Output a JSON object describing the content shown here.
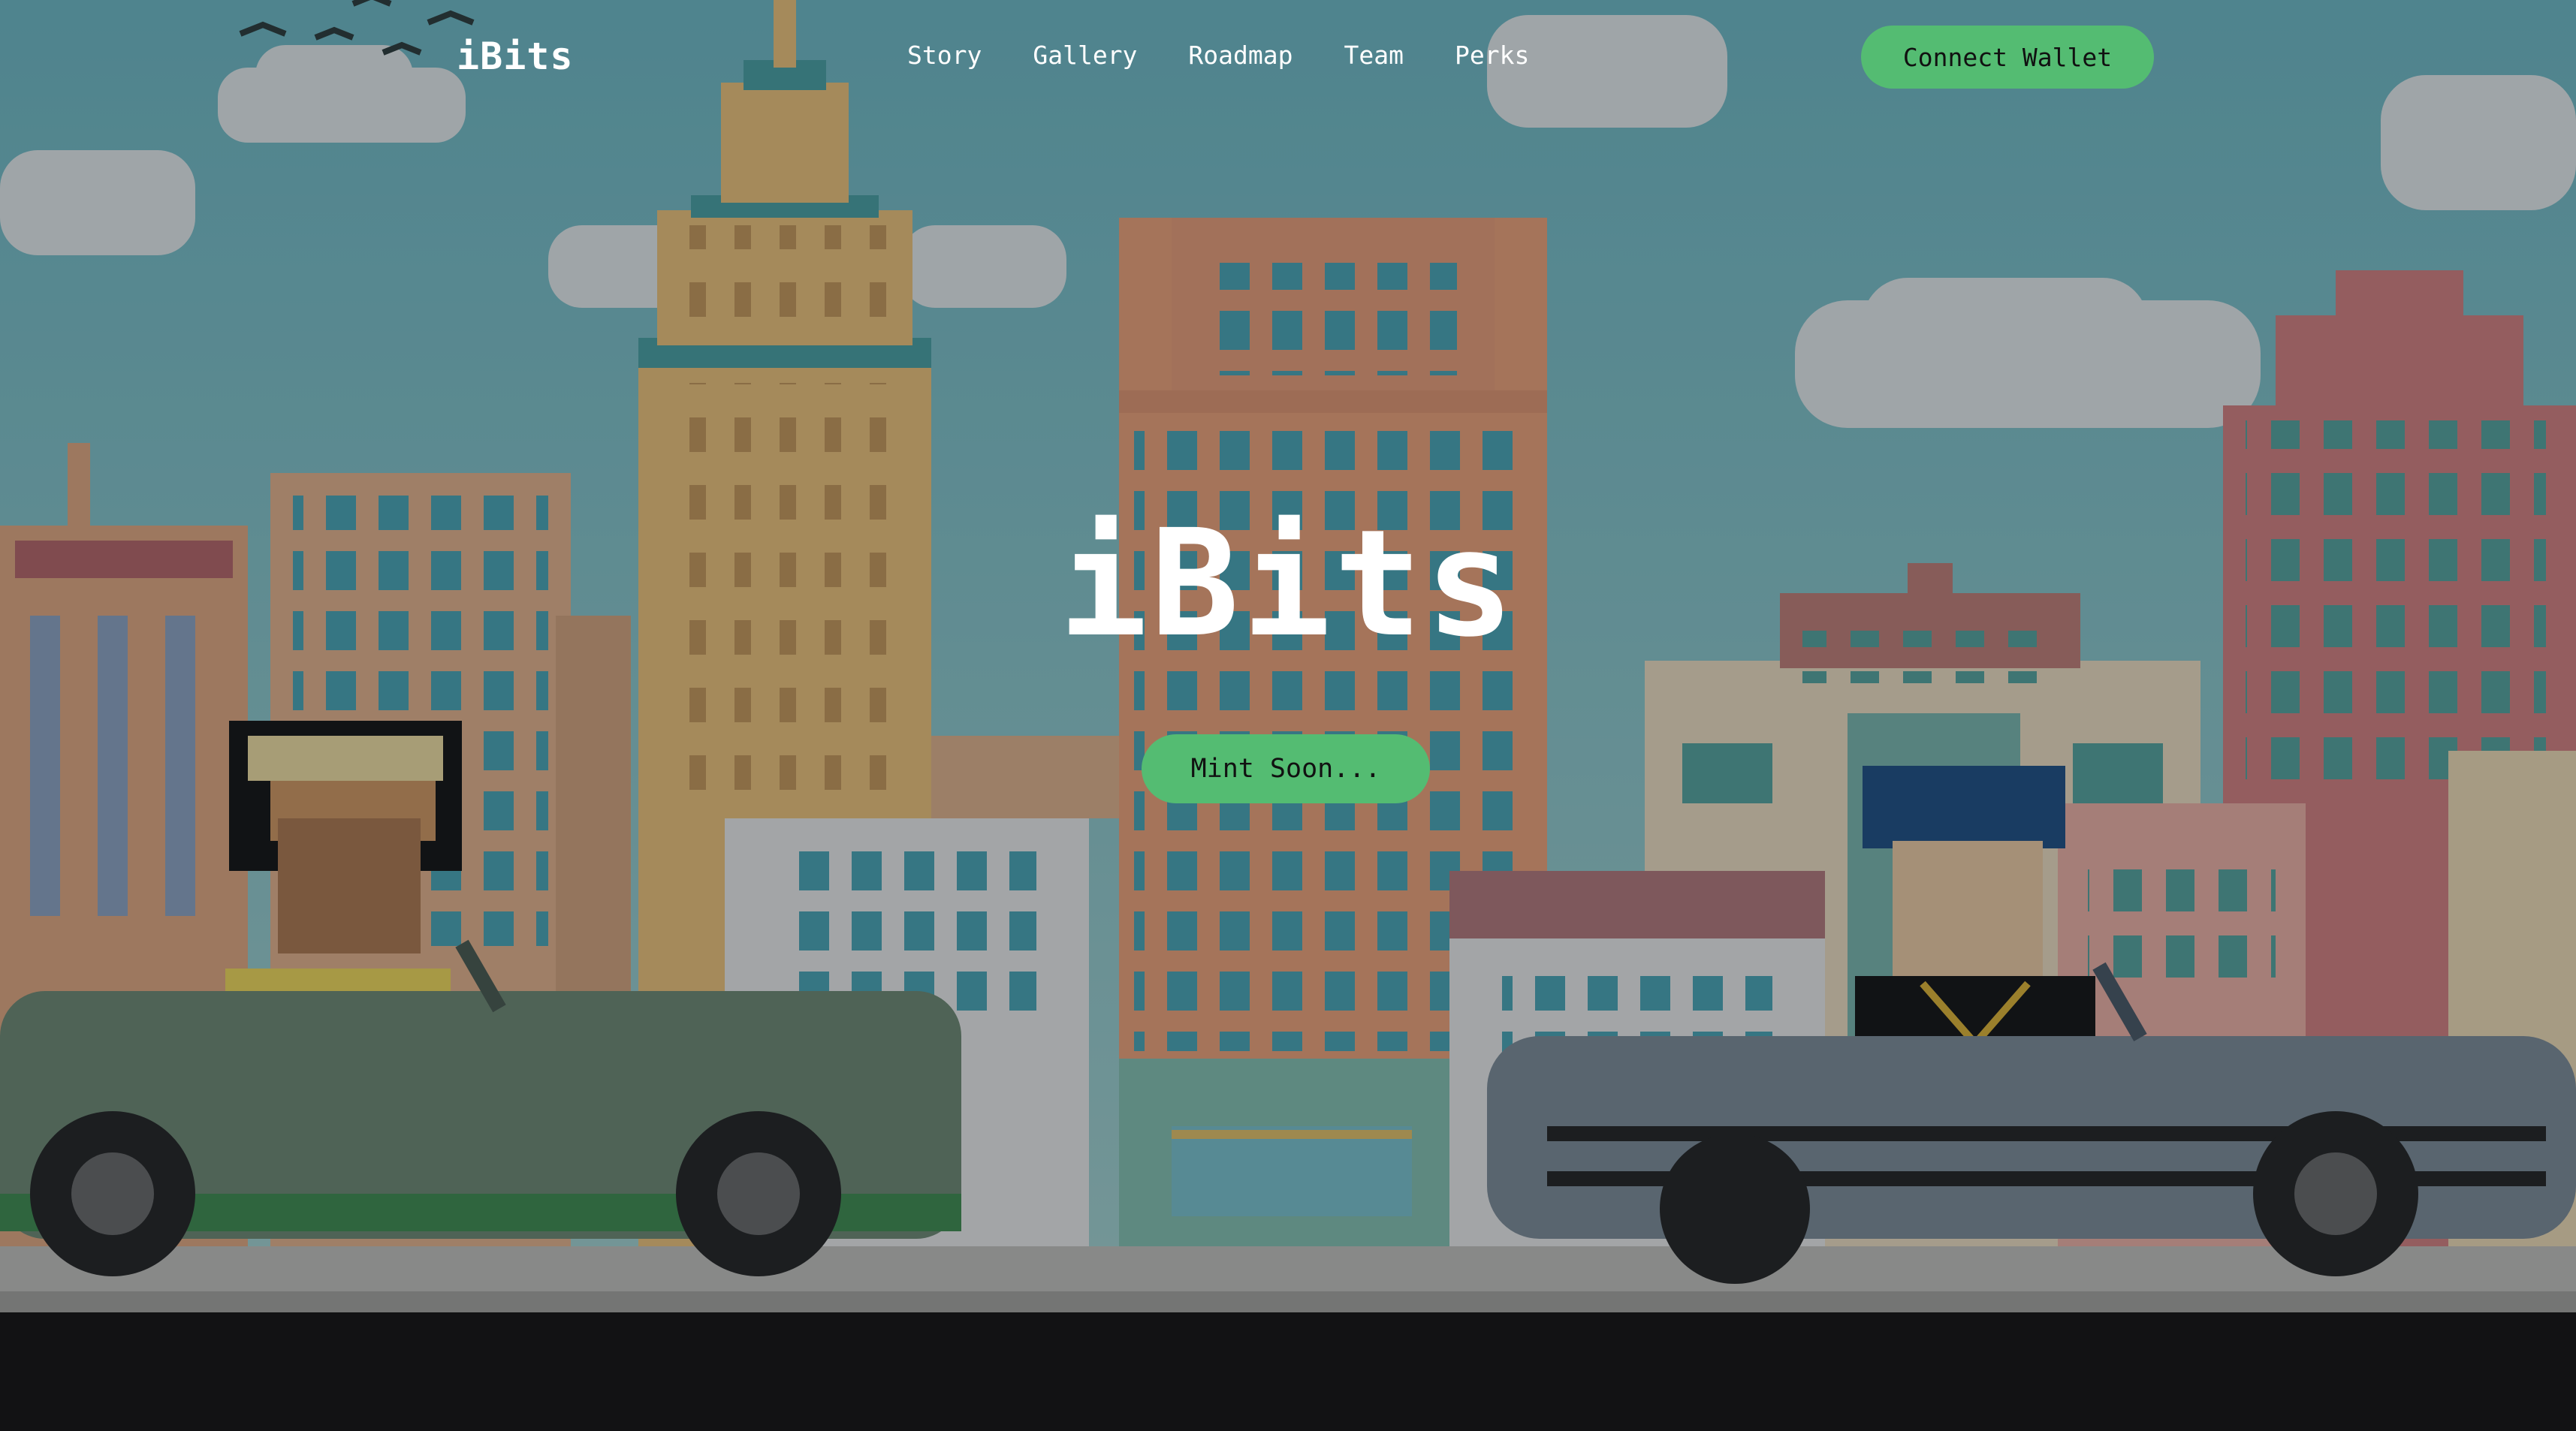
{
  "nav": {
    "logo": "iBits",
    "links": [
      "Story",
      "Gallery",
      "Roadmap",
      "Team",
      "Perks"
    ],
    "connect_label": "Connect Wallet"
  },
  "hero": {
    "title": "iBits",
    "mint_label": "Mint Soon..."
  },
  "colors": {
    "accent_green": "#54bc72",
    "footer_bg": "#121214",
    "sky": "#7fc3cc"
  }
}
